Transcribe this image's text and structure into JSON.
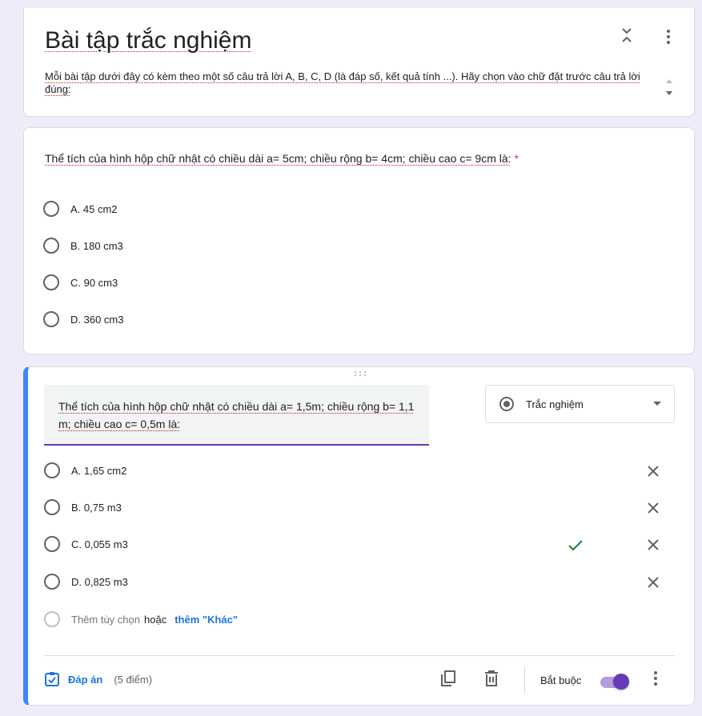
{
  "header": {
    "title": "Bài tập trắc nghiệm",
    "description": "Mỗi bài tập dưới đây có kèm theo một số câu trả lời A, B, C, D (là đáp số, kết quả tính ...). Hãy chọn vào chữ đặt trước câu trả lời đúng:",
    "collapse_icon": "collapse-icon",
    "more_icon": "more-vert-icon"
  },
  "question1": {
    "title": "Thể tích của hình hộp chữ nhật có chiều dài a= 5cm; chiều rộng b= 4cm; chiều cao c= 9cm là:",
    "required_marker": "*",
    "options": [
      "A. 45 cm2",
      "B. 180 cm3",
      "C. 90 cm3",
      "D. 360 cm3"
    ]
  },
  "question2": {
    "title": "Thể tích của hình hộp chữ nhật có chiều dài a= 1,5m; chiều rộng b= 1,1 m; chiều cao c= 0,5m là:",
    "type_label": "Trắc nghiệm",
    "options": [
      "A. 1,65 cm2",
      "B. 0,75 m3",
      "C. 0,055 m3",
      "D. 0,825 m3"
    ],
    "correct_option_index": 2,
    "add_option": "Thêm tùy chọn",
    "or": "hoặc",
    "add_other": "thêm \"Khác\"",
    "answer_key_label": "Đáp án",
    "points": "(5 điểm)",
    "required_label": "Bắt buộc",
    "required_on": true
  },
  "colors": {
    "accent": "#673ab7",
    "active_border": "#4285f4",
    "link": "#1a73e8",
    "correct": "#188038",
    "required_star": "#d93025"
  }
}
